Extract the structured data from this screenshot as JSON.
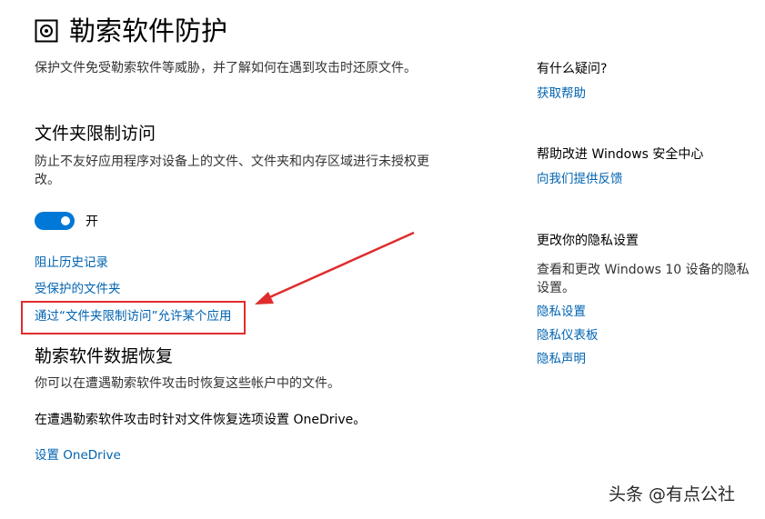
{
  "header": {
    "title": "勒索软件防护",
    "icon": "shield-settings-icon",
    "description": "保护文件免受勒索软件等威胁，并了解如何在遇到攻击时还原文件。"
  },
  "folder_access": {
    "title": "文件夹限制访问",
    "description_line1": "防止不友好应用程序对设备上的文件、文件夹和内存区域进行未授权更",
    "description_line2": "改。",
    "toggle_state": "开",
    "toggle_on": true,
    "links": [
      "阻止历史记录",
      "受保护的文件夹",
      "通过“文件夹限制访问”允许某个应用"
    ]
  },
  "recovery": {
    "title": "勒索软件数据恢复",
    "description": "你可以在遭遇勒索软件攻击时恢复这些帐户中的文件。",
    "onedrive_text": "在遭遇勒索软件攻击时针对文件恢复选项设置 OneDrive。",
    "setup_link": "设置 OneDrive"
  },
  "sidebar": {
    "questions_title": "有什么疑问?",
    "help_link": "获取帮助",
    "improve_title": "帮助改进 Windows 安全中心",
    "feedback_link": "向我们提供反馈",
    "privacy_title": "更改你的隐私设置",
    "privacy_desc_line1": "查看和更改 Windows 10 设备的隐私",
    "privacy_desc_line2": "设置。",
    "privacy_links": [
      "隐私设置",
      "隐私仪表板",
      "隐私声明"
    ]
  },
  "watermark": "头条 @有点公社",
  "colors": {
    "link": "#0063b1",
    "toggle": "#0078d7",
    "annotation": "#e02c2c"
  }
}
